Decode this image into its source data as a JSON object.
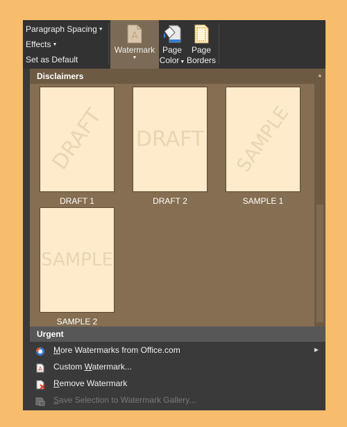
{
  "ribbon": {
    "paragraph_spacing": "Paragraph Spacing",
    "effects": "Effects",
    "set_as_default": "Set as Default",
    "watermark": "Watermark",
    "page_color_line1": "Page",
    "page_color_line2": "Color",
    "page_borders_line1": "Page",
    "page_borders_line2": "Borders"
  },
  "sections": {
    "disclaimers": "Disclaimers",
    "urgent": "Urgent"
  },
  "gallery": [
    {
      "caption": "DRAFT 1",
      "watermark_text": "DRAFT",
      "style": "diagonal"
    },
    {
      "caption": "DRAFT 2",
      "watermark_text": "DRAFT",
      "style": "horizontal"
    },
    {
      "caption": "SAMPLE 1",
      "watermark_text": "SAMPLE",
      "style": "diagonal"
    },
    {
      "caption": "SAMPLE 2",
      "watermark_text": "SAMPLE",
      "style": "horizontal"
    }
  ],
  "menu": {
    "more_watermarks": {
      "pre": "",
      "ul": "M",
      "post": "ore Watermarks from Office.com"
    },
    "custom_watermark": {
      "pre": "Custom ",
      "ul": "W",
      "post": "atermark..."
    },
    "remove_watermark": {
      "pre": "",
      "ul": "R",
      "post": "emove Watermark"
    },
    "save_selection": {
      "pre": "",
      "ul": "S",
      "post": "ave Selection to Watermark Gallery..."
    }
  },
  "colors": {
    "page_background": "#f7bd6c",
    "gallery_background": "#856e51",
    "thumbnail_page": "#feebcb",
    "watermark_text": "#e9d5b2"
  }
}
